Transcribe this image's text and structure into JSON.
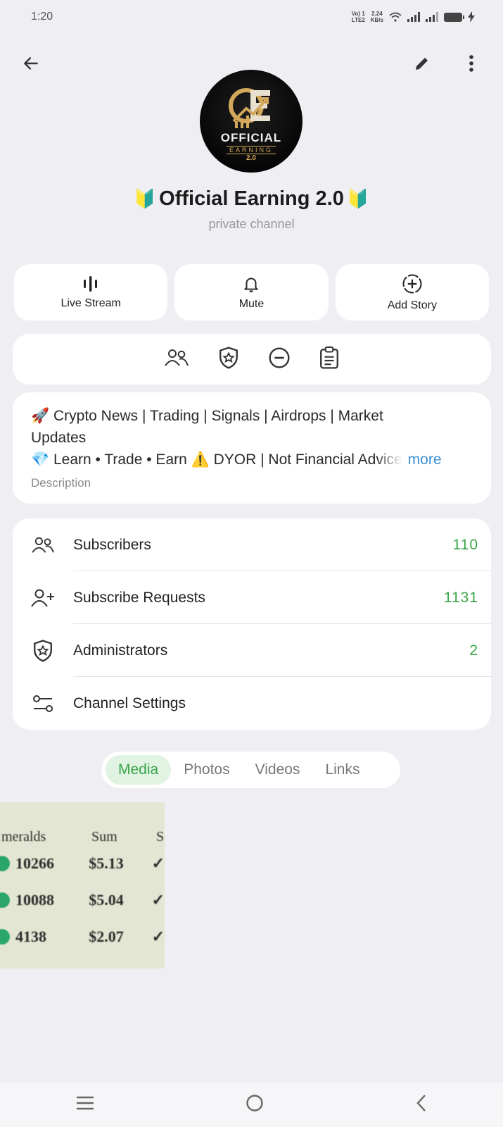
{
  "status_bar": {
    "time": "1:20",
    "volte_top": "Vo) 1",
    "volte_bottom": "LTE2",
    "speed_value": "2.24",
    "speed_unit": "KB/s"
  },
  "topbar": {
    "back_icon": "arrow-left-icon",
    "edit_icon": "pencil-icon",
    "more_icon": "more-vertical-icon"
  },
  "avatar": {
    "logo_line1": "OFFICIAL",
    "logo_line2": "EARNING",
    "logo_line3": "2.0"
  },
  "channel": {
    "title": "Official Earning 2.0",
    "title_emoji_left": "🔰",
    "title_emoji_right": "🔰",
    "subtitle": "private channel"
  },
  "actions": [
    {
      "label": "Live Stream",
      "icon": "live-stream-icon"
    },
    {
      "label": "Mute",
      "icon": "bell-icon"
    },
    {
      "label": "Add Story",
      "icon": "add-story-icon"
    }
  ],
  "quick_icons": [
    "members-icon",
    "admin-shield-icon",
    "restrict-icon",
    "clipboard-icon"
  ],
  "description": {
    "line1": "🚀 Crypto News | Trading | Signals | Airdrops | Market",
    "line2": "Updates",
    "line3": "💎 Learn • Trade • Earn ⚠️ DYOR | Not Financial Advice",
    "more": "more",
    "label": "Description"
  },
  "info_rows": [
    {
      "label": "Subscribers",
      "value": "110",
      "icon": "users-icon"
    },
    {
      "label": "Subscribe Requests",
      "value": "1131",
      "icon": "user-add-icon"
    },
    {
      "label": "Administrators",
      "value": "2",
      "icon": "shield-star-icon"
    },
    {
      "label": "Channel Settings",
      "value": "",
      "icon": "settings-sliders-icon"
    }
  ],
  "tabs": [
    {
      "label": "Media",
      "active": true
    },
    {
      "label": "Photos",
      "active": false
    },
    {
      "label": "Videos",
      "active": false
    },
    {
      "label": "Links",
      "active": false
    }
  ],
  "media_preview": {
    "headers": [
      "meralds",
      "Sum",
      "S"
    ],
    "rows": [
      {
        "emeralds": "10266",
        "sum": "$5.13"
      },
      {
        "emeralds": "10088",
        "sum": "$5.04"
      },
      {
        "emeralds": "4138",
        "sum": "$2.07"
      }
    ]
  },
  "colors": {
    "accent_green": "#3aa44a",
    "link_blue": "#3a8fd1",
    "background": "#efeff3"
  }
}
